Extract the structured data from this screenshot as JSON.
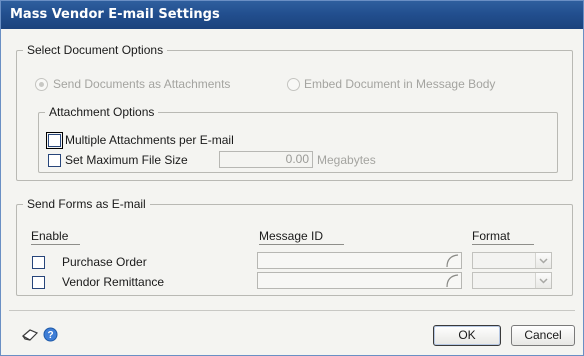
{
  "window": {
    "title": "Mass Vendor E-mail Settings"
  },
  "document_options": {
    "legend": "Select Document Options",
    "radio_attachments": "Send Documents as Attachments",
    "radio_embed": "Embed Document in Message Body",
    "attachment_options": {
      "legend": "Attachment Options",
      "multiple_label": "Multiple Attachments per E-mail",
      "max_size_label": "Set Maximum File Size",
      "max_size_value": "0.00",
      "max_size_unit": "Megabytes"
    }
  },
  "send_forms": {
    "legend": "Send Forms as E-mail",
    "col_enable": "Enable",
    "col_message_id": "Message ID",
    "col_format": "Format",
    "rows": [
      {
        "label": "Purchase Order"
      },
      {
        "label": "Vendor Remittance"
      }
    ]
  },
  "footer": {
    "ok_label": "OK",
    "cancel_label": "Cancel"
  }
}
